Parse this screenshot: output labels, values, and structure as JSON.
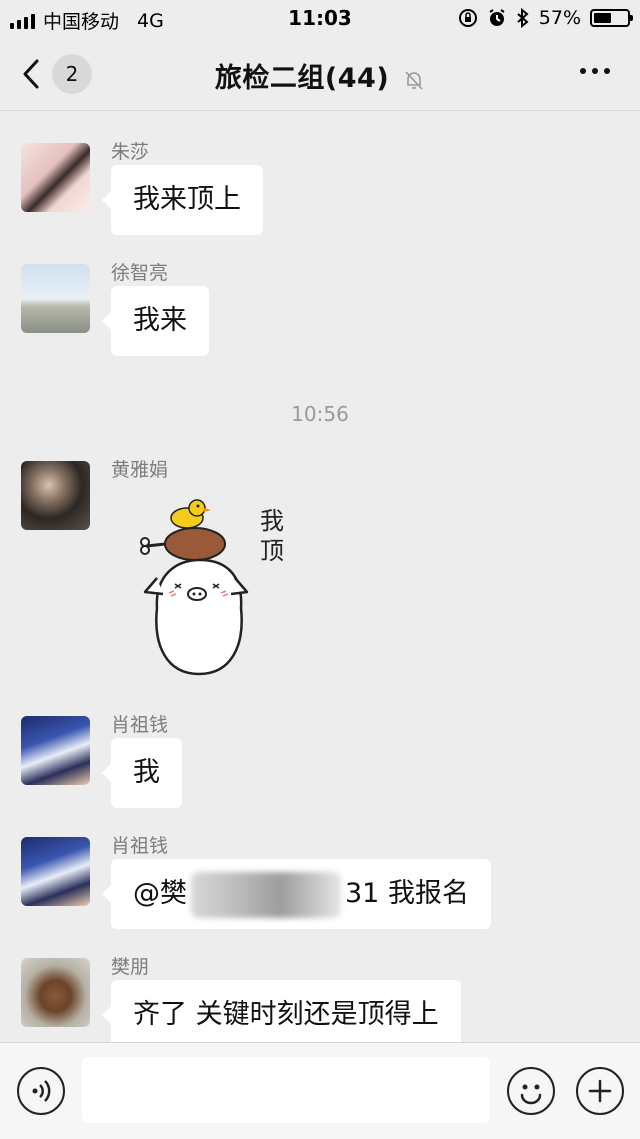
{
  "status_bar": {
    "carrier": "中国移动",
    "network": "4G",
    "time": "11:03",
    "battery": "57%",
    "battery_level": 0.57
  },
  "header": {
    "back_badge": "2",
    "title": "旅检二组(44)"
  },
  "timestamp": "10:56",
  "messages": [
    {
      "sender": "朱莎",
      "text": "我来顶上"
    },
    {
      "sender": "徐智亮",
      "text": "我来"
    },
    {
      "sender": "黄雅娟",
      "sticker_text": "我顶"
    },
    {
      "sender": "肖祖钱",
      "text": "我"
    },
    {
      "sender": "肖祖钱",
      "text_prefix": "@樊",
      "text_suffix": "31 我报名"
    },
    {
      "sender": "樊朋",
      "text": "齐了 关键时刻还是顶得上"
    }
  ],
  "input": {
    "value": ""
  },
  "icons": {
    "back": "chevron-left-icon",
    "mute": "bell-off-icon",
    "more": "more-icon",
    "voice": "voice-icon",
    "emoji": "emoji-icon",
    "add": "plus-icon"
  }
}
